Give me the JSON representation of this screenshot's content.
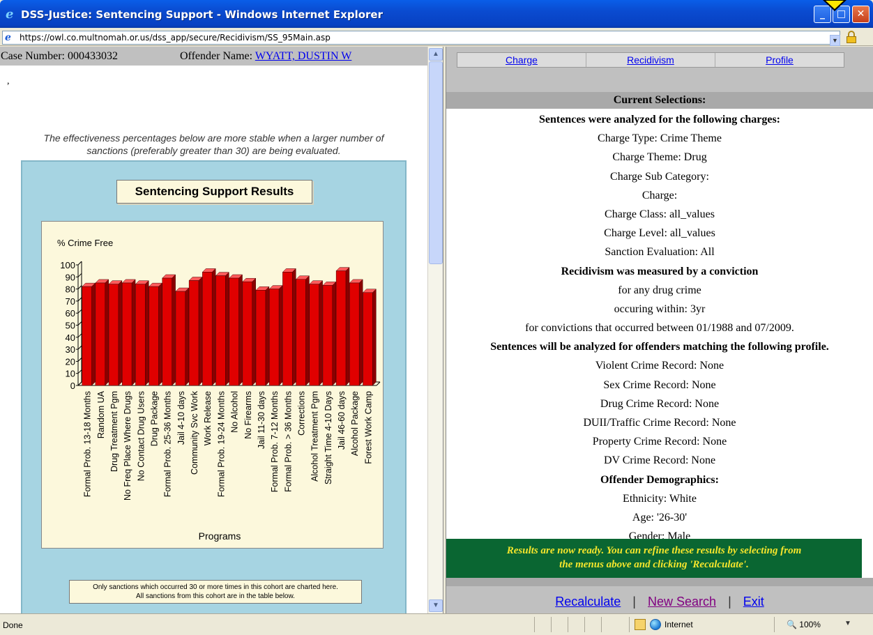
{
  "window": {
    "title": "DSS-Justice: Sentencing Support - Windows Internet Explorer",
    "url": "https://owl.co.multnomah.or.us/dss_app/secure/Recidivism/SS_95Main.asp",
    "minimize_icon": "minimize-icon",
    "maximize_icon": "maximize-icon",
    "close_icon": "close-icon"
  },
  "left": {
    "case_label": "Case Number: 000433032",
    "offender_label": "Offender Name:",
    "offender_name": "WYATT, DUSTIN W",
    "stray": ",",
    "note_line1": "The effectiveness percentages below are more stable when a larger number of",
    "note_line2": "sanctions (preferably greater than 30) are being evaluated.",
    "chart_title": "Sentencing Support Results",
    "footnote_line1": "Only sanctions which occurred 30 or more times in this cohort are charted here.",
    "footnote_line2": "All sanctions from this cohort are in the table below."
  },
  "chart_data": {
    "type": "bar",
    "title": "Sentencing Support Results",
    "ylabel": "% Crime Free",
    "xlabel": "Programs",
    "ylim": [
      0,
      100
    ],
    "yticks": [
      0,
      10,
      20,
      30,
      40,
      50,
      60,
      70,
      80,
      90,
      100
    ],
    "categories": [
      "Formal Prob. 13-18 Months",
      "Random UA",
      "Drug Treatment Pgm",
      "No Freq Place Where Drugs",
      "No Contact Drug Users",
      "Drug Package",
      "Formal Prob. 25-36 Months",
      "Jail 4-10 days",
      "Community Svc Work",
      "Work Release",
      "Formal Prob. 19-24 Months",
      "No Alcohol",
      "No Firearms",
      "Jail 11-30 days",
      "Formal Prob. 7-12 Months",
      "Formal Prob. > 36 Months",
      "Corrections",
      "Alcohol Treatment Pgm",
      "Straight Time 4-10 Days",
      "Jail 46-60 days",
      "Alcohol Package",
      "Forest Work Camp"
    ],
    "values": [
      82,
      85,
      84,
      85,
      84,
      82,
      89,
      78,
      87,
      94,
      91,
      89,
      86,
      79,
      80,
      94,
      88,
      84,
      83,
      95,
      85,
      77
    ],
    "colors": {
      "bar": "#e00000",
      "bar_side": "#8a0000",
      "bar_top": "#ff5c5c"
    },
    "grid": false,
    "legend": "none"
  },
  "right": {
    "nav": [
      "Charge",
      "Recidivism",
      "Profile"
    ],
    "current_selections": "Current Selections:",
    "lines": [
      {
        "text": "Sentences were analyzed for the following charges:",
        "bold": true
      },
      {
        "text": "Charge Type: Crime Theme",
        "bold": false
      },
      {
        "text": "Charge Theme: Drug",
        "bold": false
      },
      {
        "text": "Charge Sub Category:",
        "bold": false
      },
      {
        "text": "Charge:",
        "bold": false
      },
      {
        "text": "Charge Class: all_values",
        "bold": false
      },
      {
        "text": "Charge Level: all_values",
        "bold": false
      },
      {
        "text": "Sanction Evaluation: All",
        "bold": false
      },
      {
        "text": "Recidivism was measured by a conviction",
        "bold": true
      },
      {
        "text": "for any drug crime",
        "bold": false
      },
      {
        "text": "occuring within: 3yr",
        "bold": false
      },
      {
        "text": "for convictions that occurred between 01/1988 and 07/2009.",
        "bold": false
      },
      {
        "text": "Sentences will be analyzed for offenders matching the following profile.",
        "bold": true
      },
      {
        "text": "Violent Crime Record: None",
        "bold": false
      },
      {
        "text": "Sex Crime Record: None",
        "bold": false
      },
      {
        "text": "Drug Crime Record: None",
        "bold": false
      },
      {
        "text": "DUII/Traffic Crime Record: None",
        "bold": false
      },
      {
        "text": "Property Crime Record: None",
        "bold": false
      },
      {
        "text": "DV Crime Record: None",
        "bold": false
      },
      {
        "text": "Offender Demographics:",
        "bold": true
      },
      {
        "text": "Ethnicity: White",
        "bold": false
      },
      {
        "text": "Age: '26-30'",
        "bold": false
      },
      {
        "text": "Gender: Male",
        "bold": false
      }
    ],
    "ready_line1": "Results are now ready. You can refine these results by selecting from",
    "ready_line2": "the menus above and clicking 'Recalculate'.",
    "recalculate": "Recalculate",
    "new_search": "New Search",
    "exit": "Exit",
    "separator": "|"
  },
  "status": {
    "text": "Done",
    "zone": "Internet",
    "zoom": "100%"
  }
}
